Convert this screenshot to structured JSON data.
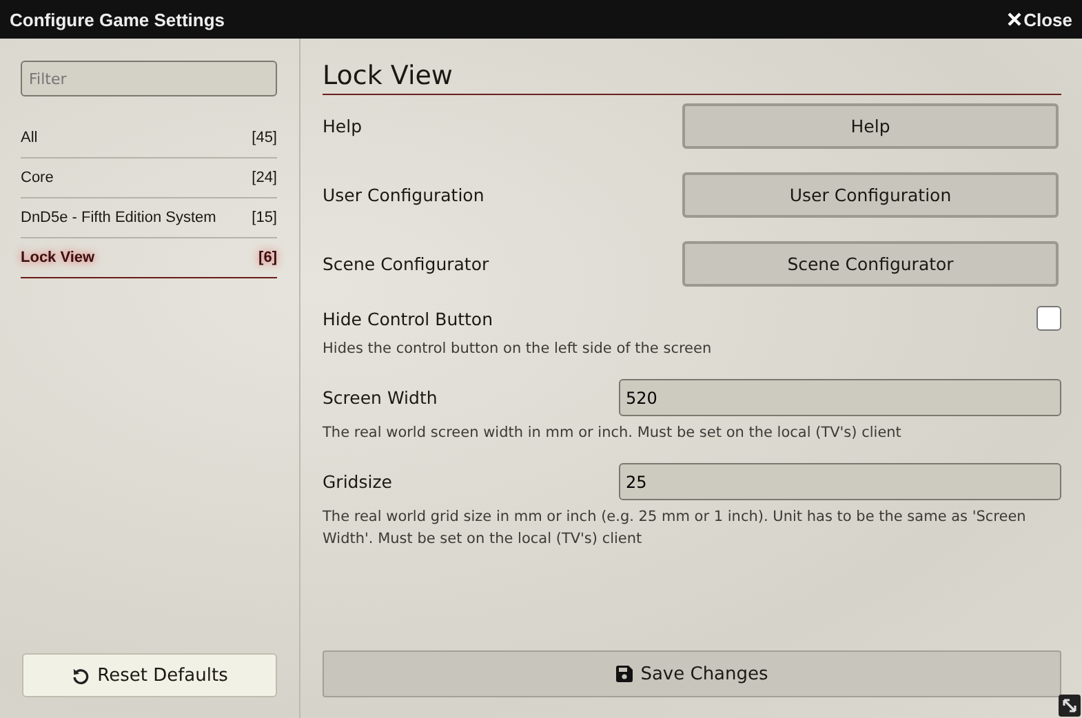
{
  "window": {
    "title": "Configure Game Settings",
    "close": {
      "label": "Close"
    }
  },
  "sidebar": {
    "filter": {
      "placeholder": "Filter"
    },
    "items": [
      {
        "label": "All",
        "count": "[45]",
        "selected": false
      },
      {
        "label": "Core",
        "count": "[24]",
        "selected": false
      },
      {
        "label": "DnD5e - Fifth Edition System",
        "count": "[15]",
        "selected": false
      },
      {
        "label": "Lock View",
        "count": "[6]",
        "selected": true
      }
    ],
    "reset_button": "Reset Defaults"
  },
  "content": {
    "heading": "Lock View",
    "settings": [
      {
        "kind": "button",
        "label": "Help",
        "button": "Help"
      },
      {
        "kind": "button",
        "label": "User Configuration",
        "button": "User Configuration"
      },
      {
        "kind": "button",
        "label": "Scene Configurator",
        "button": "Scene Configurator"
      },
      {
        "kind": "checkbox",
        "label": "Hide Control Button",
        "checked": false,
        "hint": "Hides the control button on the left side of the screen"
      },
      {
        "kind": "number",
        "label": "Screen Width",
        "value": "520",
        "hint": "The real world screen width in mm or inch. Must be set on the local (TV's) client"
      },
      {
        "kind": "number",
        "label": "Gridsize",
        "value": "25",
        "hint": "The real world grid size in mm or inch (e.g. 25 mm or 1 inch). Unit has to be the same as 'Screen Width'. Must be set on the local (TV's) client"
      }
    ],
    "save_button": "Save Changes"
  }
}
